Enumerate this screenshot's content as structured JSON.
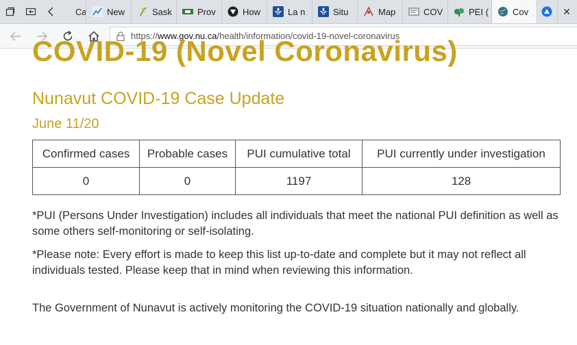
{
  "browser": {
    "tabs": [
      {
        "label": "Case",
        "favicon": "page-icon",
        "color": "#1a73e8"
      },
      {
        "label": "New",
        "favicon": "chart-icon",
        "color": "#2a7ab8"
      },
      {
        "label": "Sask",
        "favicon": "wheat-icon",
        "color": "#e0b800"
      },
      {
        "label": "Prov",
        "favicon": "flag-icon",
        "color": "#2e7d32"
      },
      {
        "label": "How",
        "favicon": "shield-icon",
        "color": "#222222"
      },
      {
        "label": "La n",
        "favicon": "fleur-de-lis-icon",
        "color": "#1f4f9c"
      },
      {
        "label": "Situ",
        "favicon": "fleur-de-lis-icon",
        "color": "#1f4f9c"
      },
      {
        "label": "Map",
        "favicon": "map-icon",
        "color": "#c0392b"
      },
      {
        "label": "COV",
        "favicon": "document-icon",
        "color": "#455a64"
      },
      {
        "label": "PEI (",
        "favicon": "tree-icon",
        "color": "#2e8b57"
      },
      {
        "label": "Cov",
        "favicon": "globe-icon",
        "color": "#3b6e8f"
      }
    ],
    "url_prefix": "https://",
    "url_host": "www.gov.nu.ca",
    "url_path": "/health/information/covid-19-novel-coronavirus"
  },
  "page": {
    "title": "COVID-19 (Novel Coronavirus)",
    "subtitle": "Nunavut COVID-19 Case Update",
    "date": "June 11/20",
    "table": {
      "headers": [
        "Confirmed cases",
        "Probable cases",
        "PUI cumulative total",
        "PUI currently under investigation"
      ],
      "row": [
        "0",
        "0",
        "1197",
        "128"
      ]
    },
    "note_pui": "*PUI (Persons Under Investigation) includes all individuals that meet the national PUI definition as well as some others self-monitoring or self-isolating.",
    "note_disclaimer": "*Please note: Every effort is made to keep this list up-to-date and complete but it may not reflect all individuals tested. Please keep that in mind when reviewing this information.",
    "note_monitoring": "The Government of Nunavut is actively monitoring the COVID-19 situation nationally and globally."
  },
  "colors": {
    "heading_gold": "#c9a21f",
    "tab_strip": "#dee1e6"
  }
}
